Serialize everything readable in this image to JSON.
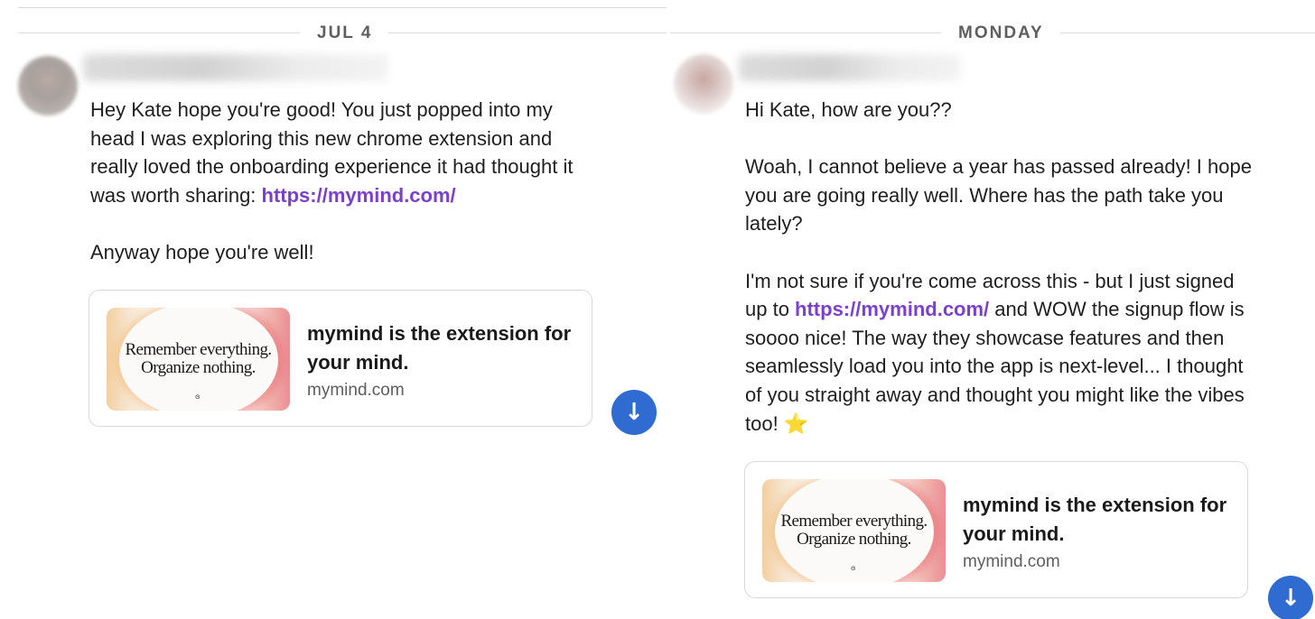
{
  "left": {
    "date": "JUL 4",
    "message": {
      "p1_text": "Hey Kate hope you're good! You just popped into my head I was exploring this new chrome extension and really loved the onboarding experience it had thought it was worth sharing: ",
      "p1_link": "https://mymind.com/",
      "p2": "Anyway hope you're well!"
    },
    "card": {
      "thumb_line1": "Remember everything.",
      "thumb_line2": "Organize nothing.",
      "title": "mymind is the extension for your mind.",
      "domain": "mymind.com"
    },
    "scroll_icon": "↓"
  },
  "right": {
    "date": "MONDAY",
    "message": {
      "p1": "Hi Kate, how are you??",
      "p2": "Woah, I cannot believe a year has passed already! I hope you are going really well. Where has the path take you lately?",
      "p3_before": "I'm not sure if you're come across this - but I just signed up to ",
      "p3_link": "https://mymind.com/",
      "p3_after": " and WOW the signup flow is soooo nice! The way they showcase features and then seamlessly load you into the app is next-level... I thought of you straight away and thought you might like the vibes too! ⭐"
    },
    "card": {
      "thumb_line1": "Remember everything.",
      "thumb_line2": "Organize nothing.",
      "title": "mymind is the extension for your mind.",
      "domain": "mymind.com"
    },
    "scroll_icon": "↓"
  },
  "colors": {
    "link": "#7b3fd1",
    "scroll_button": "#2f6bd0",
    "date_label": "#5f5f5f"
  },
  "icons": {
    "avatar": "avatar-blurred",
    "scroll": "arrow-down-icon"
  }
}
